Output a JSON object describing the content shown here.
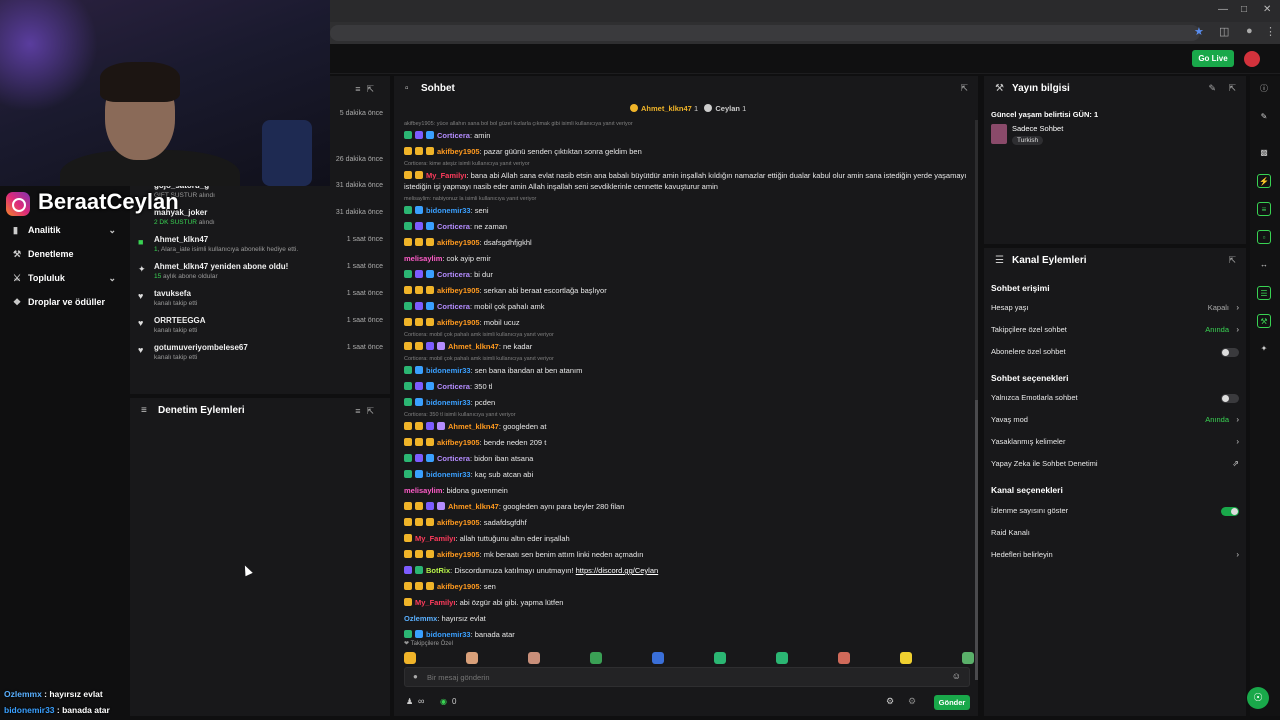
{
  "streamer": {
    "name": "BeraatCeylan"
  },
  "app": {
    "go_live": "Go Live"
  },
  "nav": [
    {
      "label": "Analitik",
      "icon": "chart-icon",
      "glyph": "▮",
      "chev": "⌄"
    },
    {
      "label": "Denetleme",
      "icon": "hammer-icon",
      "glyph": "⚒",
      "chev": ""
    },
    {
      "label": "Topluluk",
      "icon": "community-icon",
      "glyph": "⚔",
      "chev": "⌄"
    },
    {
      "label": "Droplar ve ödüller",
      "icon": "gift-icon",
      "glyph": "❖",
      "chev": ""
    }
  ],
  "activity": {
    "items": [
      {
        "icon": "",
        "name": "",
        "sub": "",
        "time": "5 dakika önce"
      },
      {
        "icon": "",
        "name": "",
        "sub": "",
        "time": "26 dakika önce"
      },
      {
        "icon": "",
        "name": "gojo_satoru_g",
        "sub_a": "",
        "sub_b": "GIFT SUSTUR alındı",
        "time": "31 dakika önce"
      },
      {
        "icon": "",
        "name": "mahyak_joker",
        "sub_a": "2 DK SUSTUR",
        "sub_b": " alındı",
        "time": "31 dakika önce"
      },
      {
        "icon": "■",
        "name": "Ahmet_klkn47",
        "sub_a": "1",
        "sub_b": ", Alara_iate isimli kullanıcıya abonelik hediye etti.",
        "time": "1 saat önce"
      },
      {
        "icon": "✦",
        "name": "Ahmet_klkn47 yeniden abone oldu!",
        "sub_a": "15",
        "sub_b": " aylık abone oldular",
        "time": "1 saat önce"
      },
      {
        "icon": "♥",
        "name": "tavuksefa",
        "sub_a": "",
        "sub_b": "kanalı takip etti",
        "time": "1 saat önce"
      },
      {
        "icon": "♥",
        "name": "ORRTEEGGA",
        "sub_a": "",
        "sub_b": "kanalı takip etti",
        "time": "1 saat önce"
      },
      {
        "icon": "♥",
        "name": "gotumuveriyombelese67",
        "sub_a": "",
        "sub_b": "kanalı takip etti",
        "time": "1 saat önce"
      }
    ]
  },
  "moderation": {
    "title": "Denetim Eylemleri"
  },
  "chat": {
    "title": "Sohbet",
    "pinned_a": "Ahmet_klkn47",
    "pinned_a_count": "1",
    "pinned_b": "Ceylan",
    "pinned_b_count": "1",
    "messages": [
      {
        "type": "reply",
        "text": "akifbey1905: yüce allahın sana bol bol güzel kızlarla çıkmak gibi isimli kullanıcıya yanıt veriyor"
      },
      {
        "badges": [
          "#2bb673",
          "#7d5cff",
          "#3aa0ff"
        ],
        "user": "Corticera",
        "color": "#b48cff",
        "text": ": amin"
      },
      {
        "badges": [
          "#f0b429",
          "#f0b429",
          "#f0b429"
        ],
        "user": "akifbey1905",
        "color": "#ff9a1f",
        "text": ": pazar güünü senden çıktıktan sonra geldim ben"
      },
      {
        "type": "reply",
        "text": "Corticera: kime ateşiz isimli kullanıcıya yanıt veriyor"
      },
      {
        "type": "wrap",
        "badges": [
          "#f0b429",
          "#f0b429"
        ],
        "user": "My_Familyı",
        "color": "#ff3b5c",
        "text": ": bana abi Allah sana evlat nasib etsin ana babalı büyütdür amin inşallah kıldığın namazlar ettiğin dualar kabul olur amin sana istediğin yerde yaşamayı istediğin işi yapmayı nasib eder amin Allah inşallah seni sevdiklerinle cennette kavuşturur amin"
      },
      {
        "type": "reply",
        "text": "melisaylim: nabiyonuz la isimli kullanıcıya yanıt veriyor"
      },
      {
        "badges": [
          "#2bb673",
          "#3aa0ff"
        ],
        "user": "bidonemir33",
        "color": "#3aa0ff",
        "text": ": seni"
      },
      {
        "badges": [
          "#2bb673",
          "#7d5cff",
          "#3aa0ff"
        ],
        "user": "Corticera",
        "color": "#b48cff",
        "text": ": ne zaman"
      },
      {
        "badges": [
          "#f0b429",
          "#f0b429",
          "#f0b429"
        ],
        "user": "akifbey1905",
        "color": "#ff9a1f",
        "text": ": dsafsgdhfjgkhl"
      },
      {
        "badges": [],
        "user": "melisaylim",
        "color": "#ff5cc8",
        "text": ": cok ayip emir"
      },
      {
        "badges": [
          "#2bb673",
          "#7d5cff",
          "#3aa0ff"
        ],
        "user": "Corticera",
        "color": "#b48cff",
        "text": ": bi dur"
      },
      {
        "badges": [
          "#f0b429",
          "#f0b429",
          "#f0b429"
        ],
        "user": "akifbey1905",
        "color": "#ff9a1f",
        "text": ": serkan abi beraat escortlağa başlıyor"
      },
      {
        "badges": [
          "#2bb673",
          "#7d5cff",
          "#3aa0ff"
        ],
        "user": "Corticera",
        "color": "#b48cff",
        "text": ": mobil çok pahalı amk"
      },
      {
        "badges": [
          "#f0b429",
          "#f0b429",
          "#f0b429"
        ],
        "user": "akifbey1905",
        "color": "#ff9a1f",
        "text": ": mobil ucuz"
      },
      {
        "type": "reply",
        "text": "Corticera: mobil çok pahalı amk isimli kullanıcıya yanıt veriyor"
      },
      {
        "badges": [
          "#f0b429",
          "#f0b429",
          "#7d5cff",
          "#b48cff"
        ],
        "user": "Ahmet_klkn47",
        "color": "#ff9a1f",
        "text": ": ne kadar"
      },
      {
        "type": "reply",
        "text": "Corticera: mobil çok pahalı amk isimli kullanıcıya yanıt veriyor"
      },
      {
        "badges": [
          "#2bb673",
          "#3aa0ff"
        ],
        "user": "bidonemir33",
        "color": "#3aa0ff",
        "text": ": sen bana ibandan at ben atanım"
      },
      {
        "badges": [
          "#2bb673",
          "#7d5cff",
          "#3aa0ff"
        ],
        "user": "Corticera",
        "color": "#b48cff",
        "text": ": 350 tl"
      },
      {
        "badges": [
          "#2bb673",
          "#3aa0ff"
        ],
        "user": "bidonemir33",
        "color": "#3aa0ff",
        "text": ": pcden"
      },
      {
        "type": "reply",
        "text": "Corticera: 350 tl isimli kullanıcıya yanıt veriyor"
      },
      {
        "badges": [
          "#f0b429",
          "#f0b429",
          "#7d5cff",
          "#b48cff"
        ],
        "user": "Ahmet_klkn47",
        "color": "#ff9a1f",
        "text": ": googleden at"
      },
      {
        "badges": [
          "#f0b429",
          "#f0b429",
          "#f0b429"
        ],
        "user": "akifbey1905",
        "color": "#ff9a1f",
        "text": ": bende neden 209 t"
      },
      {
        "badges": [
          "#2bb673",
          "#7d5cff",
          "#3aa0ff"
        ],
        "user": "Corticera",
        "color": "#b48cff",
        "text": ": bidon iban atsana"
      },
      {
        "badges": [
          "#2bb673",
          "#3aa0ff"
        ],
        "user": "bidonemir33",
        "color": "#3aa0ff",
        "text": ": kaç sub atcan abi"
      },
      {
        "badges": [],
        "user": "melisaylim",
        "color": "#ff5cc8",
        "text": ": bidona guvenmein"
      },
      {
        "badges": [
          "#f0b429",
          "#f0b429",
          "#7d5cff",
          "#b48cff"
        ],
        "user": "Ahmet_klkn47",
        "color": "#ff9a1f",
        "text": ": googleden aynı para beyler 280 filan"
      },
      {
        "badges": [
          "#f0b429",
          "#f0b429",
          "#f0b429"
        ],
        "user": "akifbey1905",
        "color": "#ff9a1f",
        "text": ": sadafdsgfdhf"
      },
      {
        "badges": [
          "#f0b429"
        ],
        "user": "My_Familyı",
        "color": "#ff3b5c",
        "text": ": allah tuttuğunu altın eder inşallah"
      },
      {
        "badges": [
          "#f0b429",
          "#f0b429",
          "#f0b429"
        ],
        "user": "akifbey1905",
        "color": "#ff9a1f",
        "text": ": mk beraatı sen benim attım linki neden açmadın"
      },
      {
        "badges": [
          "#7d5cff",
          "#2bb673"
        ],
        "user": "BotRix",
        "color": "#b7f24a",
        "text": ": Discordumuza katılmayı unutmayın! ",
        "link": "https://discord.gg/Ceylan"
      },
      {
        "badges": [
          "#f0b429",
          "#f0b429",
          "#f0b429"
        ],
        "user": "akifbey1905",
        "color": "#ff9a1f",
        "text": ": sen"
      },
      {
        "badges": [
          "#f0b429"
        ],
        "user": "My_Familyı",
        "color": "#ff3b5c",
        "text": ": abi özgür abi gibi. yapma lütfen"
      },
      {
        "badges": [],
        "user": "Ozlemmx",
        "color": "#5ab0ff",
        "text": ": hayırsız evlat"
      },
      {
        "badges": [
          "#2bb673",
          "#3aa0ff"
        ],
        "user": "bidonemir33",
        "color": "#3aa0ff",
        "text": ": banada atar"
      }
    ],
    "followers_only": "❤ Takipçilere Özel",
    "emote_colors": [
      "#f0b429",
      "#d9a07a",
      "#c98f7a",
      "#3aa055",
      "#3a6fd8",
      "#2bb673",
      "#2bb673",
      "#d06a5a",
      "#f0d030",
      "#5ab06a"
    ],
    "input_placeholder": "Bir mesaj gönderin",
    "viewers_sym": "∞",
    "points": "0",
    "send_label": "Gönder"
  },
  "stream_info": {
    "title": "Yayın bilgisi",
    "current_title": "Güncel yaşam belirtisi GÜN: 1",
    "category": "Sadece Sohbet",
    "tag": "Turkish"
  },
  "channel_actions": {
    "title": "Kanal Eylemleri",
    "sec_chat_access": "Sohbet erişimi",
    "password_label": "Hesap yaşı",
    "password_value": "Kapalı",
    "followers_label": "Takipçilere özel sohbet",
    "followers_value": "Anında",
    "subs_label": "Abonelere özel sohbet",
    "subs_on": false,
    "sec_chat_options": "Sohbet seçenekleri",
    "emote_only_label": "Yalnızca Emotlarla sohbet",
    "emote_only_on": false,
    "slow_mode_label": "Yavaş mod",
    "slow_mode_value": "Anında",
    "banned_words_label": "Yasaklanmış kelimeler",
    "ai_mod_label": "Yapay Zeka ile Sohbet Denetimi",
    "sec_channel_options": "Kanal seçenekleri",
    "viewer_count_label": "İzlenme sayısını göster",
    "viewer_count_on": true,
    "raid_label": "Raid Kanalı",
    "targets_label": "Hedefleri belirleyin"
  },
  "overlay_chat": [
    {
      "user": "Ozlemmx",
      "color": "#5ab0ff",
      "text": " : hayırsız evlat"
    },
    {
      "user": "bidonemir33",
      "color": "#3aa0ff",
      "text": " : banada atar"
    }
  ],
  "colors": {
    "accent": "#19a84a",
    "panel": "#18181a",
    "bg": "#0f0f10"
  }
}
